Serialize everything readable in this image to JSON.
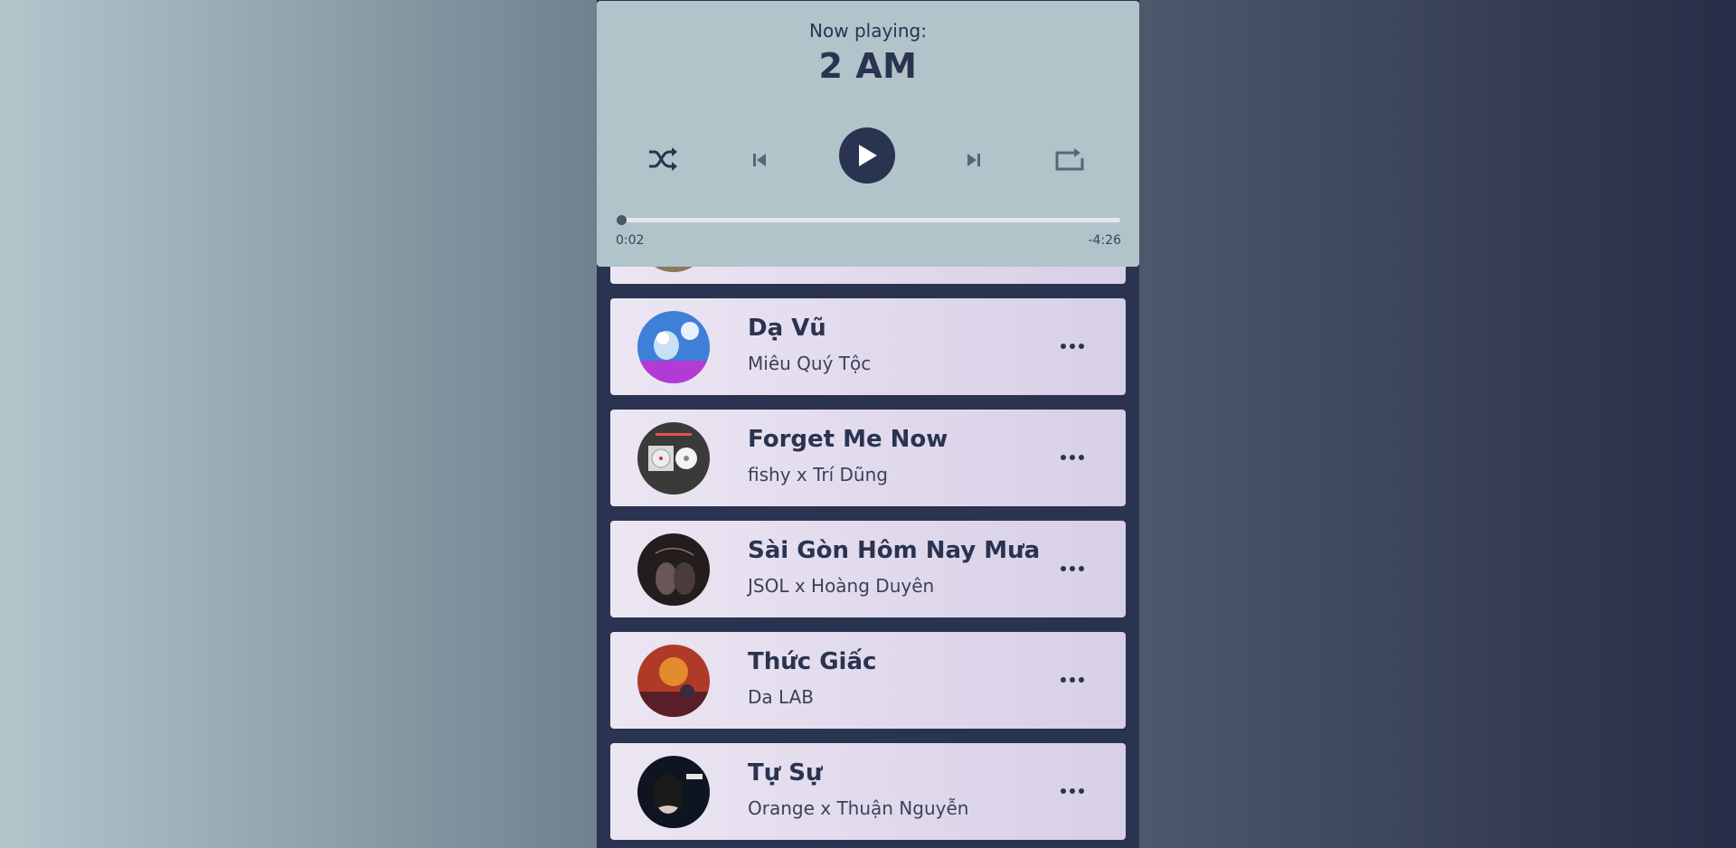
{
  "player": {
    "label": "Now playing:",
    "title": "2 AM",
    "progress_fraction": 0.008,
    "current_time": "0:02",
    "remaining_time": "-4:26",
    "controls": [
      "shuffle-icon",
      "previous-icon",
      "play-icon",
      "next-icon",
      "repeat-icon"
    ]
  },
  "songs": [
    {
      "title": "",
      "artist": "",
      "thumb_icon": "album-art"
    },
    {
      "title": "Dạ Vũ",
      "artist": "Miêu Quý Tộc",
      "thumb_icon": "album-art",
      "thumb_colors": [
        "#2f7fd6",
        "#c24ad8"
      ]
    },
    {
      "title": "Forget Me Now",
      "artist": "fishy x Trí Dũng",
      "thumb_colors": [
        "#3a3a3a",
        "#d9d9d9"
      ]
    },
    {
      "title": "Sài Gòn Hôm Nay Mưa",
      "artist": "JSOL x Hoàng Duyên",
      "thumb_colors": [
        "#231d1d",
        "#6a5656"
      ]
    },
    {
      "title": "Thức Giấc",
      "artist": "Da LAB",
      "thumb_colors": [
        "#b03a27",
        "#f0a030"
      ]
    },
    {
      "title": "Tự Sự",
      "artist": "Orange x Thuận Nguyễn",
      "thumb_colors": [
        "#0e1420",
        "#d8c9c3"
      ]
    }
  ],
  "colors": {
    "accent": "#2a3350",
    "player_bg": "#b0c4ca",
    "card_bg_start": "#ece6f3",
    "card_bg_end": "#d7cfe6"
  }
}
